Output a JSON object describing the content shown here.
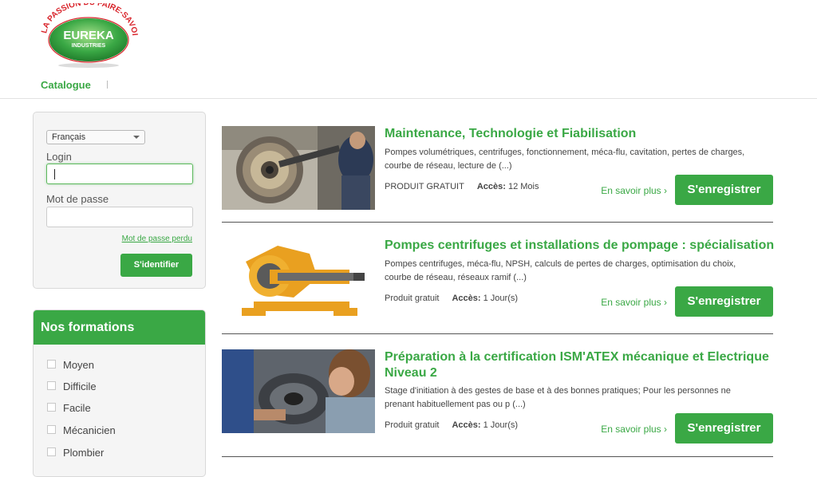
{
  "header": {
    "logo": {
      "arc_text": "LA PASSION DU FAIRE-SAVOIR",
      "brand": "EUREKA",
      "subbrand": "INDUSTRIES"
    },
    "nav": {
      "catalogue": "Catalogue"
    }
  },
  "login": {
    "language": "Français",
    "login_label": "Login",
    "login_value": "",
    "password_label": "Mot de passe",
    "password_value": "",
    "forgot": "Mot de passe perdu",
    "submit": "S'identifier"
  },
  "formations": {
    "title": "Nos formations",
    "filters": [
      "Moyen",
      "Difficile",
      "Facile",
      "Mécanicien",
      "Plombier"
    ]
  },
  "products": [
    {
      "title": "Maintenance, Technologie et Fiabilisation",
      "desc": "Pompes volumétriques, centrifuges, fonctionnement, méca-flu, cavitation, pertes de charges, courbe de réseau, lecture de (...)",
      "price": "PRODUIT GRATUIT",
      "access_label": "Accès:",
      "access_value": "12 Mois",
      "more": "En savoir plus ›",
      "register": "S'enregistrer"
    },
    {
      "title": "Pompes centrifuges et installations de pompage : spécialisation",
      "desc": "Pompes centrifuges, méca-flu, NPSH, calculs de pertes de charges, optimisation du choix, courbe de réseau, réseaux ramif (...)",
      "price": "Produit gratuit",
      "access_label": "Accès:",
      "access_value": "1 Jour(s)",
      "more": "En savoir plus ›",
      "register": "S'enregistrer"
    },
    {
      "title": "Préparation à la certification ISM'ATEX mécanique et Electrique Niveau 2",
      "desc": "Stage d'initiation à des gestes de base et à des bonnes pratiques; Pour les personnes ne prenant habituellement pas ou p (...)",
      "price": "Produit gratuit",
      "access_label": "Accès:",
      "access_value": "1 Jour(s)",
      "more": "En savoir plus ›",
      "register": "S'enregistrer"
    }
  ],
  "colors": {
    "brand_green": "#3aa845",
    "logo_red": "#d8232a"
  }
}
